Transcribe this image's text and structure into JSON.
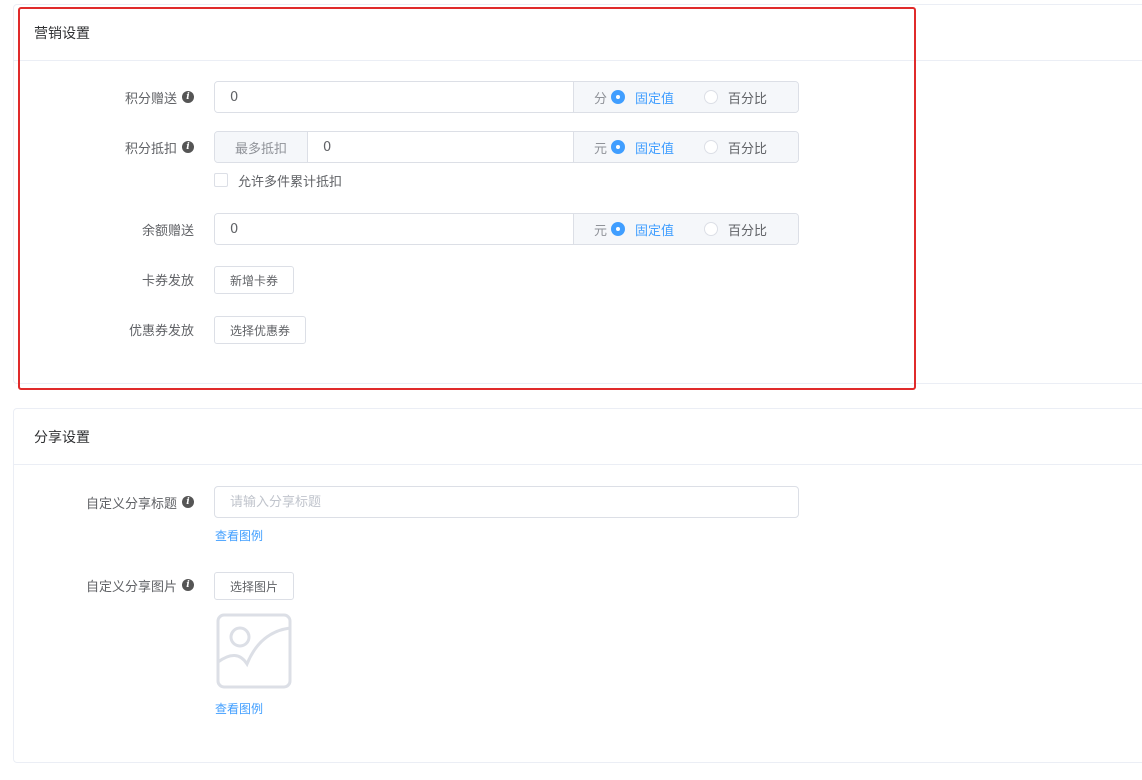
{
  "marketing": {
    "title": "营销设置",
    "points_gift": {
      "label": "积分赠送",
      "value": "0",
      "unit": "分",
      "options": [
        "固定值",
        "百分比"
      ],
      "selected": "固定值"
    },
    "points_deduct": {
      "label": "积分抵扣",
      "prepend": "最多抵扣",
      "value": "0",
      "unit": "元",
      "options": [
        "固定值",
        "百分比"
      ],
      "selected": "固定值",
      "checkbox_label": "允许多件累计抵扣"
    },
    "balance_gift": {
      "label": "余额赠送",
      "value": "0",
      "unit": "元",
      "options": [
        "固定值",
        "百分比"
      ],
      "selected": "固定值"
    },
    "card_issue": {
      "label": "卡券发放",
      "button": "新增卡券"
    },
    "coupon_issue": {
      "label": "优惠券发放",
      "button": "选择优惠券"
    }
  },
  "share": {
    "title": "分享设置",
    "share_title": {
      "label": "自定义分享标题",
      "placeholder": "请输入分享标题",
      "link": "查看图例"
    },
    "share_image": {
      "label": "自定义分享图片",
      "button": "选择图片",
      "link": "查看图例"
    }
  },
  "colors": {
    "accent": "#409eff",
    "highlight_border": "#e02b2b"
  }
}
